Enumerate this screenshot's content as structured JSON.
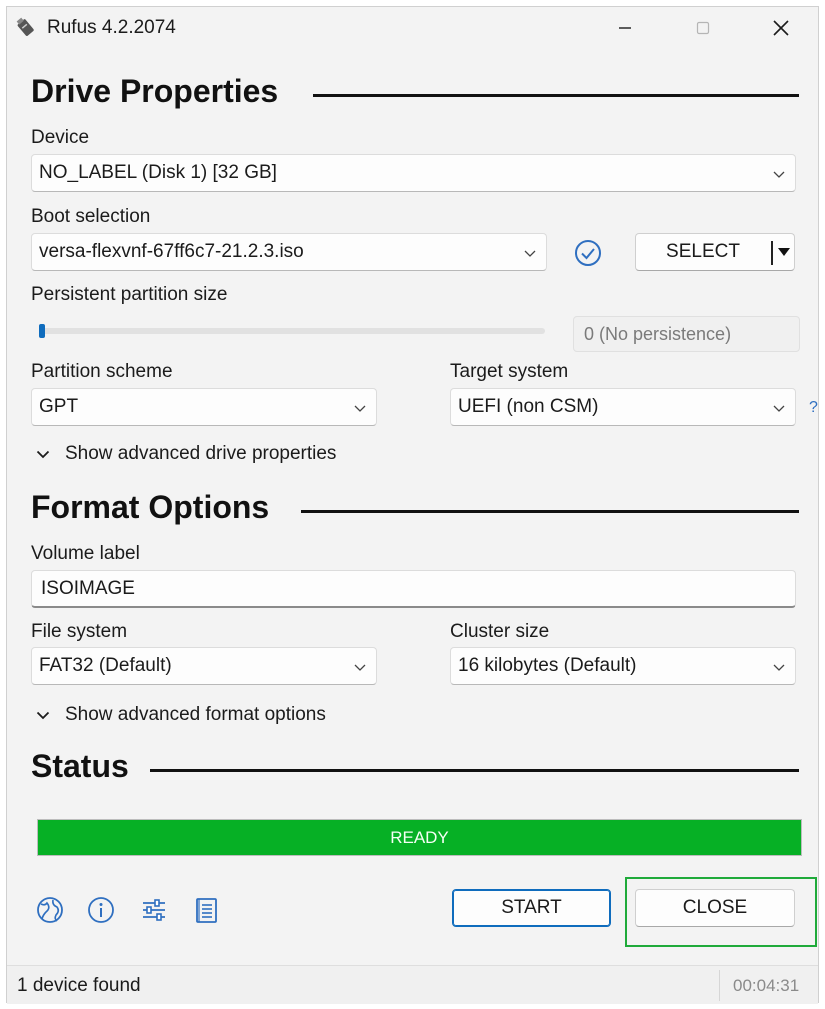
{
  "window": {
    "title": "Rufus 4.2.2074",
    "app_icon": "usb-drive-icon",
    "controls": {
      "minimize": "minimize-icon",
      "maximize": "maximize-icon",
      "close": "close-icon"
    }
  },
  "drive_properties": {
    "heading": "Drive Properties",
    "device": {
      "label": "Device",
      "value": "NO_LABEL (Disk 1) [32 GB]"
    },
    "boot_selection": {
      "label": "Boot selection",
      "value": "versa-flexvnf-67ff6c7-21.2.3.iso",
      "verify_icon": "check-circle-icon",
      "select_label": "SELECT"
    },
    "persistent": {
      "label": "Persistent partition size",
      "value": "0 (No persistence)",
      "slider_level": 0
    },
    "partition_scheme": {
      "label": "Partition scheme",
      "value": "GPT"
    },
    "target_system": {
      "label": "Target system",
      "value": "UEFI (non CSM)",
      "help": "?"
    },
    "advanced_toggle": "Show advanced drive properties"
  },
  "format_options": {
    "heading": "Format Options",
    "volume_label": {
      "label": "Volume label",
      "value": "ISOIMAGE"
    },
    "file_system": {
      "label": "File system",
      "value": "FAT32 (Default)"
    },
    "cluster_size": {
      "label": "Cluster size",
      "value": "16 kilobytes (Default)"
    },
    "advanced_toggle": "Show advanced format options"
  },
  "status": {
    "heading": "Status",
    "progress_text": "READY",
    "progress_percent": 100,
    "progress_color": "#06b025"
  },
  "toolbar": {
    "icons": [
      "globe-icon",
      "info-icon",
      "settings-sliders-icon",
      "log-icon"
    ],
    "start_label": "START",
    "close_label": "CLOSE"
  },
  "statusbar": {
    "left_text": "1 device found",
    "timer": "00:04:31"
  },
  "colors": {
    "accent": "#0f6cbd",
    "highlight": "#1faa3a"
  }
}
